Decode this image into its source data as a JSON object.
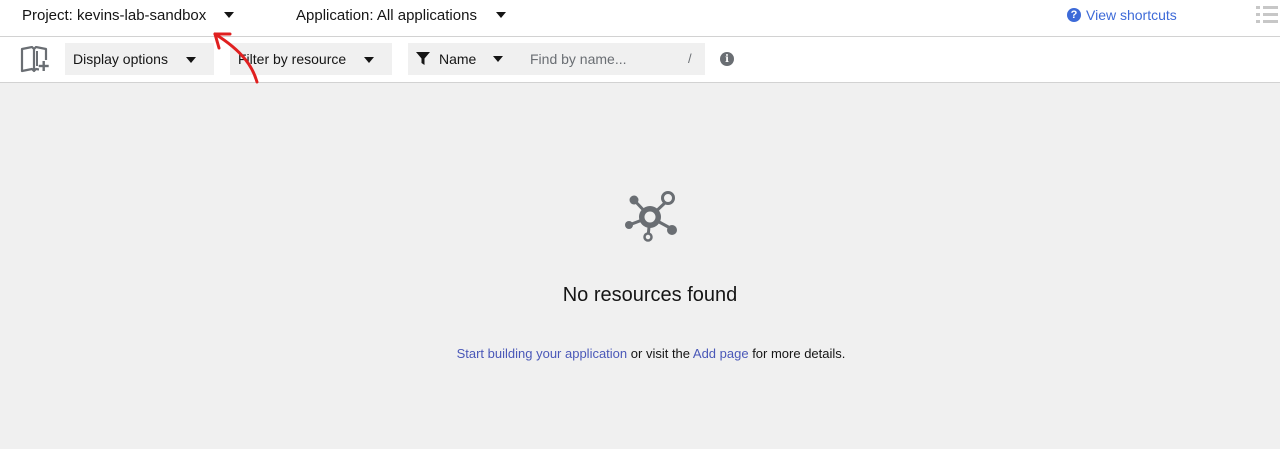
{
  "header": {
    "project_label": "Project: kevins-lab-sandbox",
    "application_label": "Application: All applications",
    "shortcuts_label": "View shortcuts"
  },
  "toolbar": {
    "display_options_label": "Display options",
    "filter_resource_label": "Filter by resource",
    "filter_type_label": "Name",
    "search_placeholder": "Find by name...",
    "search_value": "",
    "search_shortcut": "/"
  },
  "empty_state": {
    "title": "No resources found",
    "link_start": "Start building your application",
    "text_middle": " or visit the ",
    "link_add": "Add page",
    "text_end": " for more details."
  },
  "icons": {
    "help": "help-circle-icon",
    "list_view": "list-view-icon",
    "quick_search": "book-add-icon",
    "filter": "filter-icon",
    "info": "info-circle-icon",
    "empty": "topology-icon"
  },
  "colors": {
    "link": "#3d6ad8",
    "empty_link": "#4a58b8",
    "background": "#f0f0f0",
    "annotation_arrow": "#e02020"
  }
}
